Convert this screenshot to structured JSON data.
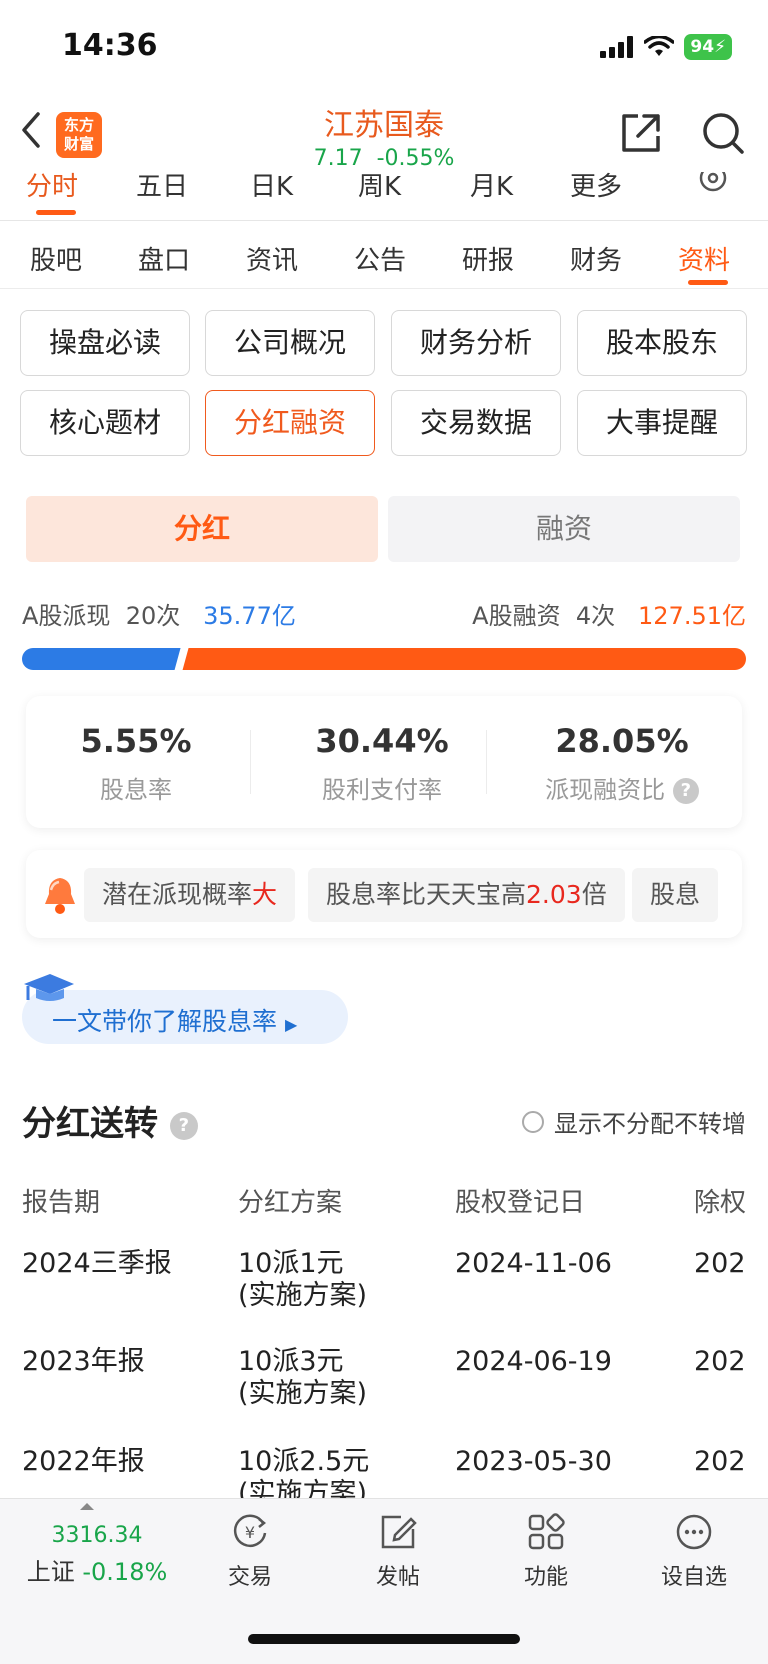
{
  "status": {
    "time": "14:36",
    "battery": "94"
  },
  "header": {
    "logo_line1": "东方",
    "logo_line2": "财富",
    "stock_name": "江苏国泰",
    "price": "7.17",
    "change": "-0.55%"
  },
  "chart_tabs": [
    "分时",
    "五日",
    "日K",
    "周K",
    "月K",
    "更多"
  ],
  "section_tabs": [
    "股吧",
    "盘口",
    "资讯",
    "公告",
    "研报",
    "财务",
    "资料"
  ],
  "grid_buttons": [
    "操盘必读",
    "公司概况",
    "财务分析",
    "股本股东",
    "核心题材",
    "分红融资",
    "交易数据",
    "大事提醒"
  ],
  "segment": {
    "on": "分红",
    "off": "融资"
  },
  "summary": {
    "left_label": "A股派现",
    "left_count": "20次",
    "left_amount": "35.77亿",
    "right_label": "A股融资",
    "right_count": "4次",
    "right_amount": "127.51亿",
    "bar_left_fraction": 0.219
  },
  "metrics": [
    {
      "value": "5.55%",
      "label": "股息率"
    },
    {
      "value": "30.44%",
      "label": "股利支付率"
    },
    {
      "value": "28.05%",
      "label": "派现融资比"
    }
  ],
  "tags": [
    {
      "text": "潜在派现概率",
      "hl": "大",
      "tail": ""
    },
    {
      "text": "股息率比天天宝高",
      "hl": "2.03",
      "tail": "倍"
    },
    {
      "text": "股息",
      "hl": "",
      "tail": ""
    }
  ],
  "learn": "一文带你了解股息率",
  "section_title": "分红送转",
  "toggle_label": "显示不分配不转增",
  "table": {
    "headers": [
      "报告期",
      "分红方案",
      "股权登记日",
      "除权"
    ],
    "rows": [
      {
        "period": "2024三季报",
        "plan1": "10派1元",
        "plan2": "(实施方案)",
        "date": "2024-11-06",
        "ex": "202"
      },
      {
        "period": "2023年报",
        "plan1": "10派3元",
        "plan2": "(实施方案)",
        "date": "2024-06-19",
        "ex": "202"
      },
      {
        "period": "2022年报",
        "plan1": "10派2.5元",
        "plan2": "(实施方案)",
        "date": "2023-05-30",
        "ex": "202"
      }
    ]
  },
  "bottom": {
    "index_value": "3316.34",
    "index_name": "上证",
    "index_change": "-0.18%",
    "items": [
      "交易",
      "发帖",
      "功能",
      "设自选"
    ]
  },
  "colors": {
    "accent": "#ff5a14",
    "blue": "#2c7be5",
    "green": "#19a54a",
    "red": "#e8281e"
  }
}
